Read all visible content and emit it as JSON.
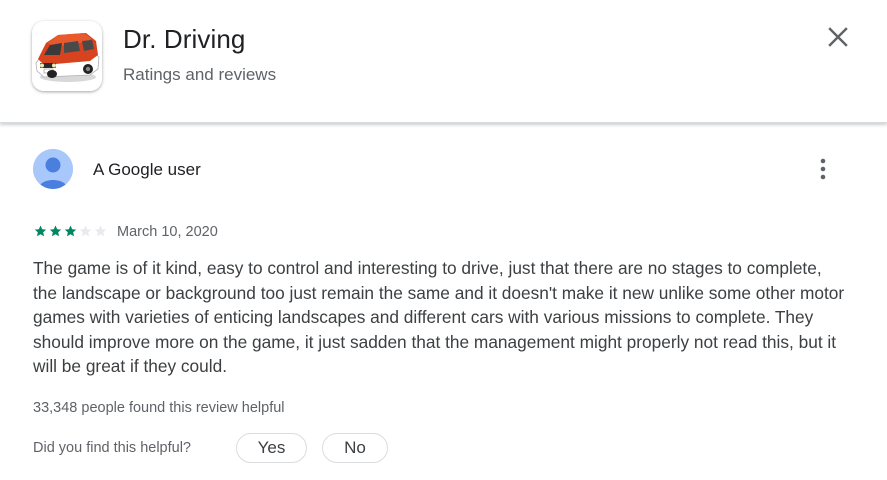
{
  "header": {
    "app_title": "Dr. Driving",
    "subtitle": "Ratings and reviews",
    "app_icon": "red-car-app-icon",
    "close_icon": "close-icon"
  },
  "review": {
    "reviewer_name": "A Google user",
    "avatar_icon": "default-avatar-icon",
    "more_icon": "more-vert-icon",
    "rating": 3,
    "rating_max": 5,
    "star_color": "#01875f",
    "star_empty_color": "#e8eaed",
    "date": "March 10, 2020",
    "text": "The game is of it kind, easy to control and interesting to drive, just that there are no stages to complete, the landscape or background too just remain the same and it doesn't make it new unlike some other motor games with varieties of enticing landscapes and different cars with various missions to complete. They should improve more on the game, it just sadden that the management might properly not read this, but it will be great if they could.",
    "helpful_count": "33,348 people found this review helpful"
  },
  "feedback": {
    "question": "Did you find this helpful?",
    "yes_label": "Yes",
    "no_label": "No"
  }
}
